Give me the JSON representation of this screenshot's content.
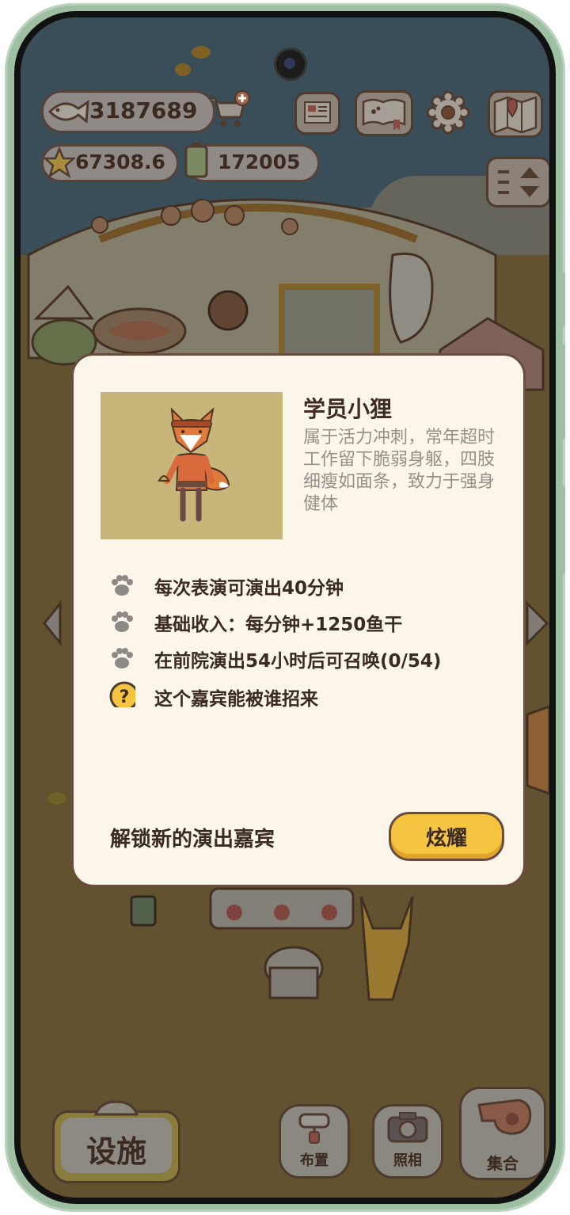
{
  "hud": {
    "fish": "3187689",
    "stars": "67308.6",
    "battery": "172005"
  },
  "dialog": {
    "guest_name": "学员小狸",
    "guest_desc": "属于活力冲刺，常年超时工作留下脆弱身躯，四肢细瘦如面条，致力于强身健体",
    "info_rows": [
      {
        "icon": "paw-icon",
        "text": "每次表演可演出40分钟"
      },
      {
        "icon": "paw-icon",
        "text": "基础收入：每分钟+1250鱼干"
      },
      {
        "icon": "paw-icon",
        "text": "在前院演出54小时后可召唤(0/54)"
      },
      {
        "icon": "question-icon",
        "text": "这个嘉宾能被谁招来"
      }
    ],
    "unlock_text": "解锁新的演出嘉宾",
    "show_button": "炫耀"
  },
  "bottom": {
    "facility": "设施",
    "layout": "布置",
    "photo": "照相",
    "gather": "集合"
  },
  "colors": {
    "dialog_bg": "#fbf5ea",
    "accent_yellow": "#f6c53f",
    "border_brown": "#6a4c3d"
  }
}
